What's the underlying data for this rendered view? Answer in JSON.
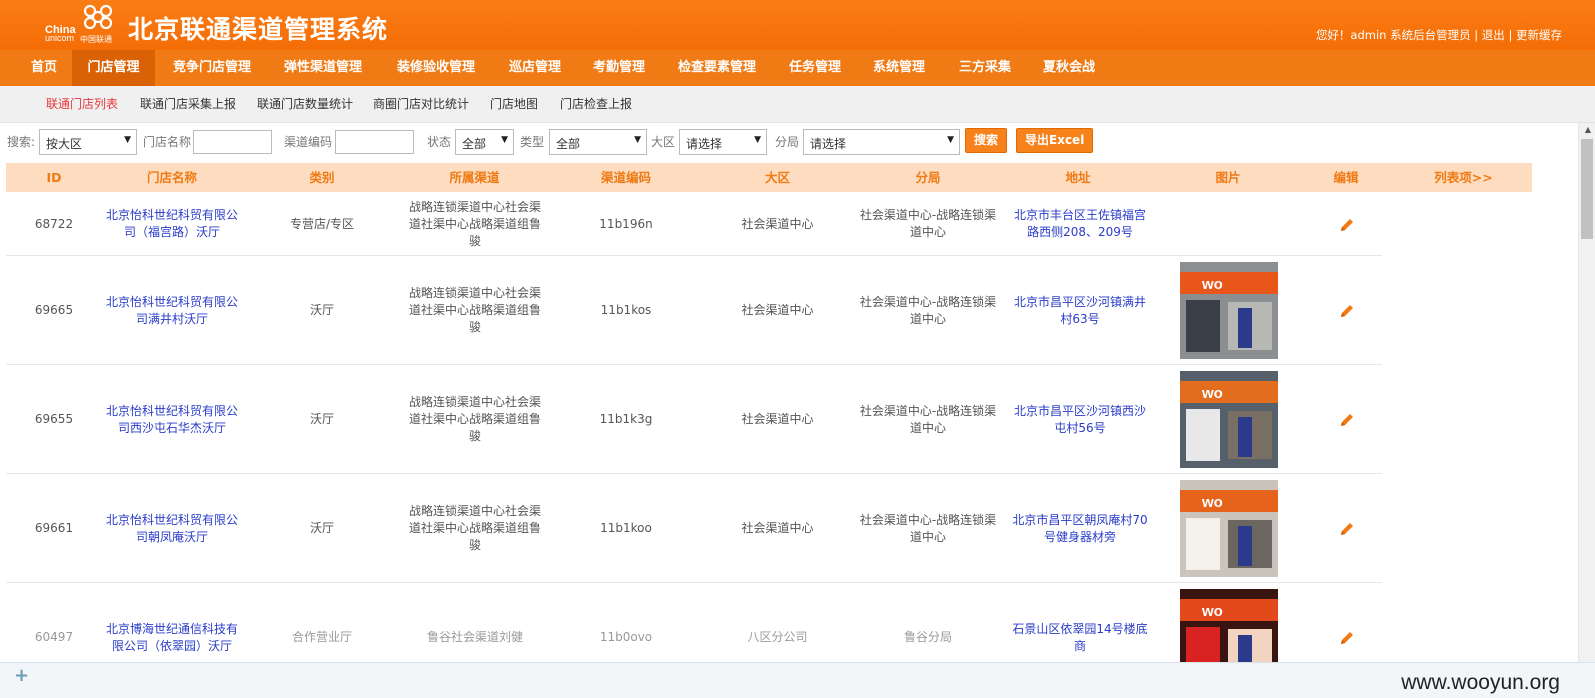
{
  "header": {
    "logo_en": "China",
    "logo_en2": "unicom",
    "logo_cn": "中国联通",
    "system_title": "北京联通渠道管理系统",
    "user_greeting": "您好！admin 系统后台管理员 | 退出 | 更新缓存"
  },
  "nav": {
    "items": [
      "首页",
      "门店管理",
      "竞争门店管理",
      "弹性渠道管理",
      "装修验收管理",
      "巡店管理",
      "考勤管理",
      "检查要素管理",
      "任务管理",
      "系统管理",
      "三方采集",
      "夏秋会战"
    ],
    "active": "门店管理"
  },
  "subnav": {
    "items": [
      "联通门店列表",
      "联通门店采集上报",
      "联通门店数量统计",
      "商圈门店对比统计",
      "门店地图",
      "门店检查上报"
    ]
  },
  "search": {
    "search_label": "搜索:",
    "search_select": "按大区",
    "store_name_label": "门店名称",
    "channel_code_label": "渠道编码",
    "status_label": "状态",
    "status_value": "全部",
    "type_label": "类型",
    "type_value": "全部",
    "region_label": "大区",
    "region_value": "请选择",
    "branch_label": "分局",
    "branch_value": "请选择",
    "search_button": "搜索",
    "export_button": "导出Excel"
  },
  "table": {
    "columns": [
      "ID",
      "门店名称",
      "类别",
      "所属渠道",
      "渠道编码",
      "大区",
      "分局",
      "地址",
      "图片",
      "编辑",
      "列表项>>"
    ],
    "rows": [
      {
        "id": "68722",
        "name": "北京怡科世纪科贸有限公司（福宫路）沃厅",
        "category": "专营店/专区",
        "channel": "战略连锁渠道中心社会渠道社渠中心战略渠道组鲁骏",
        "code": "11b196n",
        "region": "社会渠道中心",
        "branch": "社会渠道中心-战略连锁渠道中心",
        "address": "北京市丰台区王佐镇福宫路西侧208、209号",
        "photo": "none"
      },
      {
        "id": "69665",
        "name": "北京怡科世纪科贸有限公司满井村沃厅",
        "category": "沃厅",
        "channel": "战略连锁渠道中心社会渠道社渠中心战略渠道组鲁骏",
        "code": "11b1kos",
        "region": "社会渠道中心",
        "branch": "社会渠道中心-战略连锁渠道中心",
        "address": "北京市昌平区沙河镇满井村63号",
        "photo": "storefront"
      },
      {
        "id": "69655",
        "name": "北京怡科世纪科贸有限公司西沙屯石华杰沃厅",
        "category": "沃厅",
        "channel": "战略连锁渠道中心社会渠道社渠中心战略渠道组鲁骏",
        "code": "11b1k3g",
        "region": "社会渠道中心",
        "branch": "社会渠道中心-战略连锁渠道中心",
        "address": "北京市昌平区沙河镇西沙屯村56号",
        "photo": "storefront"
      },
      {
        "id": "69661",
        "name": "北京怡科世纪科贸有限公司朝凤庵沃厅",
        "category": "沃厅",
        "channel": "战略连锁渠道中心社会渠道社渠中心战略渠道组鲁骏",
        "code": "11b1koo",
        "region": "社会渠道中心",
        "branch": "社会渠道中心-战略连锁渠道中心",
        "address": "北京市昌平区朝凤庵村70号健身器材旁",
        "photo": "storefront"
      },
      {
        "id": "60497",
        "name": "北京博海世纪通信科技有限公司（依翠园）沃厅",
        "category": "合作营业厅",
        "channel": "鲁谷社会渠道刘健",
        "code": "11b0ovo",
        "region": "八区分公司",
        "branch": "鲁谷分局",
        "address": "石景山区依翠园14号楼底商",
        "photo": "storefront"
      }
    ]
  },
  "footer": {
    "watermark": "www.wooyun.org"
  },
  "colors": {
    "brand_orange": "#f07a14",
    "link_blue": "#2a3cc8",
    "active_red": "#e4393c"
  }
}
